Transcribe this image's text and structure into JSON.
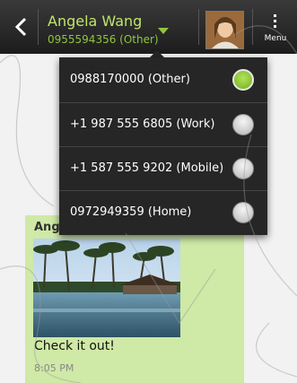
{
  "header": {
    "contact_name": "Angela Wang",
    "contact_number": "0955594356 (Other)",
    "menu_label": "Menu"
  },
  "number_picker": {
    "options": [
      {
        "label": "0988170000 (Other)",
        "selected": true
      },
      {
        "label": "+1 987 555 6805 (Work)",
        "selected": false
      },
      {
        "label": "+1 587 555 9202 (Mobile)",
        "selected": false
      },
      {
        "label": "0972949359 (Home)",
        "selected": false
      }
    ]
  },
  "conversation": {
    "message": {
      "sender": "Angela Wang",
      "text": "Check it out!",
      "time": "8:05 PM"
    }
  },
  "colors": {
    "accent_green": "#8fc63f",
    "bubble_green": "#cfe9a6",
    "popup_bg": "#262626"
  }
}
